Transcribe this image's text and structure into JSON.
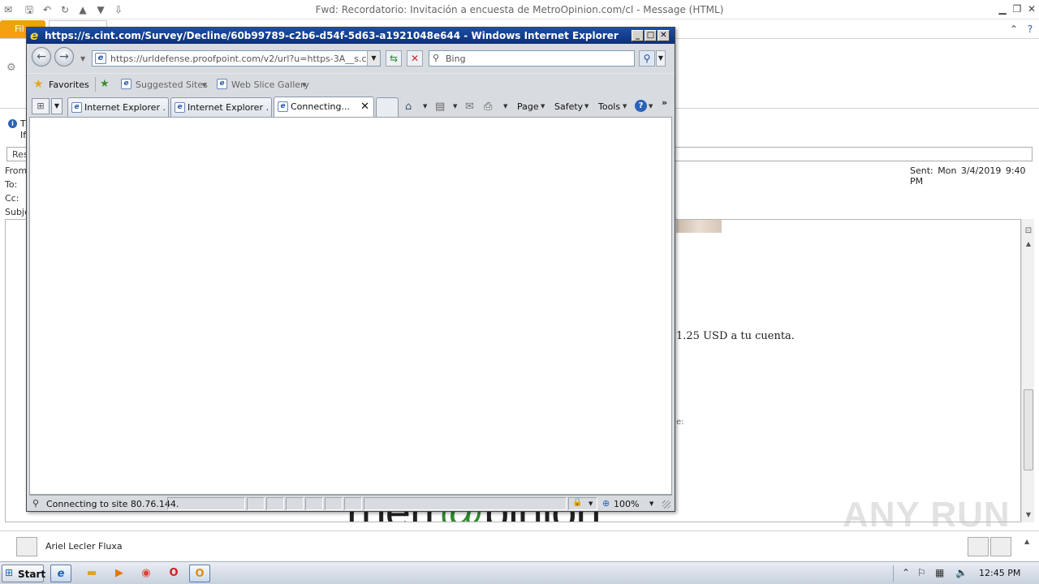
{
  "outlook": {
    "window_title": "Fwd: Recordatorio: Invitación a encuesta de MetroOpinion.com/cl  -  Message (HTML)",
    "file_tab": "Fil",
    "info_line1": "T",
    "info_line2": "If",
    "respond_box": "Res",
    "labels": {
      "from": "From",
      "to": "To:",
      "cc": "Cc:",
      "subject": "Subje"
    },
    "sent": "Sent:   Mon 3/4/2019 9:40 PM",
    "body_text": "1.25 USD a tu cuenta.",
    "body_small": "e:",
    "logo_text_left": "rnerr",
    "logo_text_at": "@",
    "logo_text_right": "pinion",
    "sender_name": "Ariel Lecler Fluxa"
  },
  "ie": {
    "title": "https://s.cint.com/Survey/Decline/60b99789-c2b6-d54f-5d63-a1921048e644 - Windows Internet Explorer",
    "address": "https://urldefense.proofpoint.com/v2/url?u=https-3A__s.cint.com",
    "search_placeholder": "Bing",
    "favorites_label": "Favorites",
    "fav_items": [
      "Suggested Sites",
      "Web Slice Gallery"
    ],
    "tabs": [
      {
        "label": "Internet Explorer ..."
      },
      {
        "label": "Internet Explorer ..."
      },
      {
        "label": "Connecting..."
      }
    ],
    "commands": {
      "page": "Page",
      "safety": "Safety",
      "tools": "Tools"
    },
    "status_text": "Connecting to site 80.76.144.",
    "zoom": "100%"
  },
  "watermark": "ANY RUN",
  "taskbar": {
    "start_label": "Start",
    "clock": "12:45 PM"
  },
  "colors": {
    "ie_title_bar": "#1b4fa6",
    "outlook_file_tab": "#f0a10b",
    "logo_accent": "#2f8a2f"
  }
}
